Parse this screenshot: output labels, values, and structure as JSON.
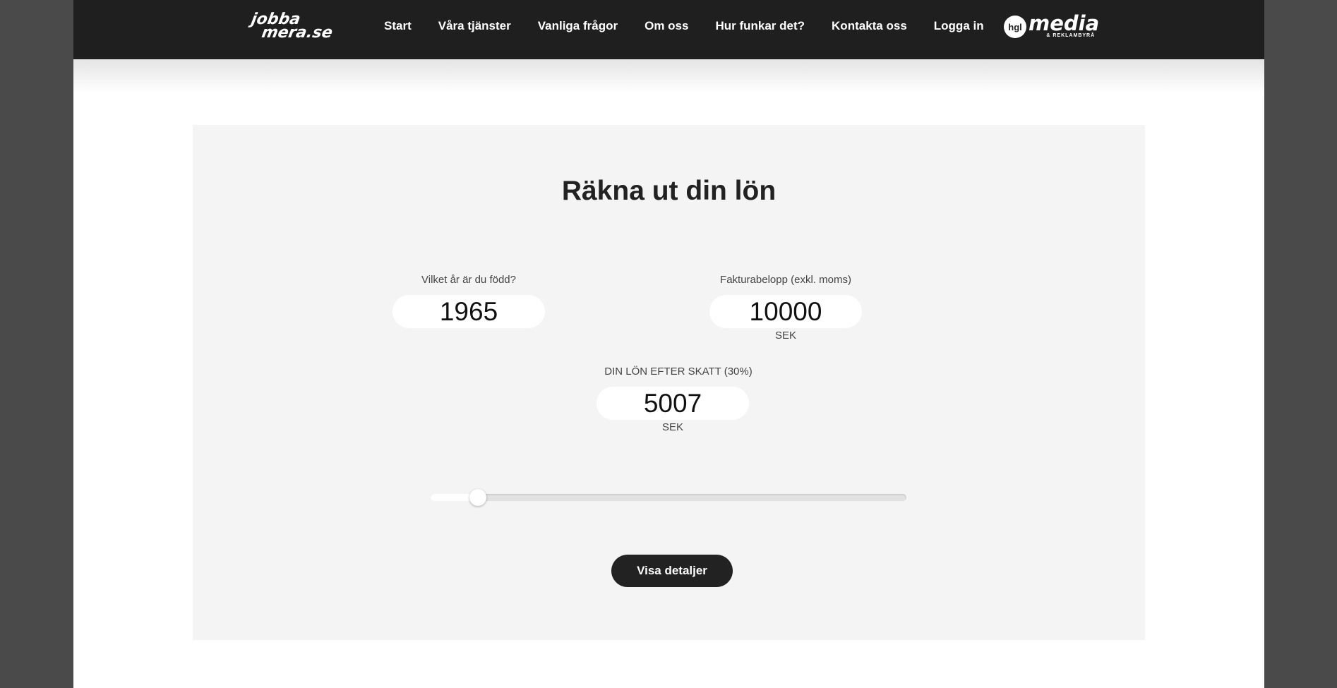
{
  "header": {
    "logo_line1": "jobba",
    "logo_line2": "mera.se",
    "nav": [
      {
        "label": "Start"
      },
      {
        "label": "Våra tjänster"
      },
      {
        "label": "Vanliga frågor"
      },
      {
        "label": "Om oss"
      },
      {
        "label": "Hur funkar det?"
      },
      {
        "label": "Kontakta oss"
      },
      {
        "label": "Logga in"
      }
    ],
    "partner": {
      "badge": "hgl",
      "name": "media",
      "sub": "& REKLAMBYRÅ"
    }
  },
  "calculator": {
    "title": "Räkna ut din lön",
    "birth_year": {
      "label": "Vilket år är du född?",
      "value": "1965"
    },
    "invoice": {
      "label": "Fakturabelopp (exkl. moms)",
      "value": "10000",
      "unit": "SEK"
    },
    "salary": {
      "label": "DIN LÖN EFTER SKATT (30%)",
      "value": "5007",
      "unit": "SEK"
    },
    "slider": {
      "value_fraction": 0.1
    },
    "details_button": "Visa detaljer"
  },
  "colors": {
    "header_bg": "#1f1f1f",
    "panel_bg": "#f4f4f4",
    "button_bg": "#222222"
  }
}
